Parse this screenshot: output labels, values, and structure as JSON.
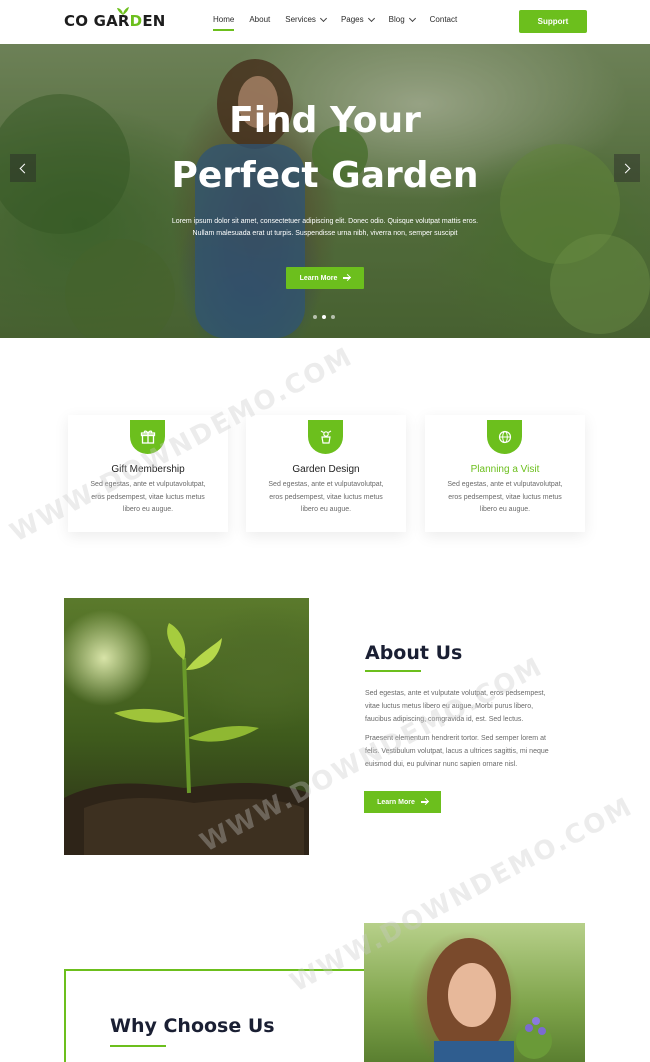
{
  "header": {
    "logo": {
      "part1": "CO GAR",
      "part2": "D",
      "part3": "EN"
    },
    "nav": [
      {
        "label": "Home",
        "active": true,
        "dropdown": false
      },
      {
        "label": "About",
        "active": false,
        "dropdown": false
      },
      {
        "label": "Services",
        "active": false,
        "dropdown": true
      },
      {
        "label": "Pages",
        "active": false,
        "dropdown": true
      },
      {
        "label": "Blog",
        "active": false,
        "dropdown": true
      },
      {
        "label": "Contact",
        "active": false,
        "dropdown": false
      }
    ],
    "support_label": "Support"
  },
  "hero": {
    "title_line1": "Find Your",
    "title_line2": "Perfect Garden",
    "text_line1": "Lorem ipsum dolor sit amet, consectetuer adipiscing elit. Donec odio. Quisque volutpat mattis eros.",
    "text_line2": "Nullam malesuada erat ut turpis. Suspendisse urna nibh, viverra non, semper suscipit",
    "button_label": "Learn More",
    "slides": 3,
    "active_slide": 1
  },
  "features": [
    {
      "title": "Gift Membership",
      "highlight": false,
      "icon": "gift-icon",
      "desc_lines": [
        "Sed egestas, ante et vulputavolutpat,",
        "eros pedsempest, vitae luctus metus",
        "libero eu augue."
      ]
    },
    {
      "title": "Garden Design",
      "highlight": false,
      "icon": "watering-can-icon",
      "desc_lines": [
        "Sed egestas, ante et vulputavolutpat,",
        "eros pedsempest, vitae luctus metus",
        "libero eu augue."
      ]
    },
    {
      "title": "Planning a Visit",
      "highlight": true,
      "icon": "globe-icon",
      "desc_lines": [
        "Sed egestas, ante et vulputavolutpat,",
        "eros pedsempest, vitae luctus metus",
        "libero eu augue."
      ]
    }
  ],
  "about": {
    "title": "About Us",
    "p1_lines": [
      "Sed egestas, ante et vulputate volutpat, eros pedsempest,",
      "vitae luctus metus libero eu augue. Morbi purus libero,",
      "faucibus adipiscing, comgravida id, est. Sed lectus."
    ],
    "p2_lines": [
      "Praesent elementum hendrerit tortor. Sed semper lorem at",
      "felis. Vestibulum volutpat, lacus a ultrices sagittis, mi neque",
      "euismod dui, eu pulvinar nunc sapien ornare nisl."
    ],
    "button_label": "Learn More"
  },
  "why": {
    "title": "Why Choose Us"
  },
  "watermark": "WWW.DOWNDEMO.COM",
  "colors": {
    "accent": "#6cbf1d",
    "heading": "#1a1f33",
    "body_text": "#6a6a6a"
  }
}
